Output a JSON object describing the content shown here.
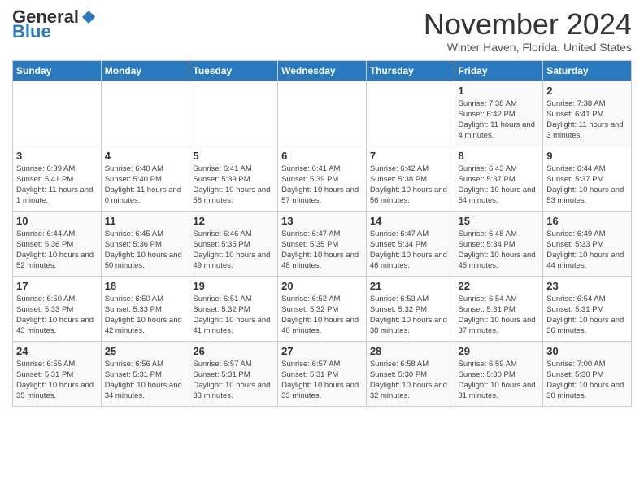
{
  "header": {
    "logo_general": "General",
    "logo_blue": "Blue",
    "month": "November 2024",
    "location": "Winter Haven, Florida, United States"
  },
  "days_of_week": [
    "Sunday",
    "Monday",
    "Tuesday",
    "Wednesday",
    "Thursday",
    "Friday",
    "Saturday"
  ],
  "weeks": [
    [
      {
        "day": "",
        "info": ""
      },
      {
        "day": "",
        "info": ""
      },
      {
        "day": "",
        "info": ""
      },
      {
        "day": "",
        "info": ""
      },
      {
        "day": "",
        "info": ""
      },
      {
        "day": "1",
        "info": "Sunrise: 7:38 AM\nSunset: 6:42 PM\nDaylight: 11 hours and 4 minutes."
      },
      {
        "day": "2",
        "info": "Sunrise: 7:38 AM\nSunset: 6:41 PM\nDaylight: 11 hours and 3 minutes."
      }
    ],
    [
      {
        "day": "3",
        "info": "Sunrise: 6:39 AM\nSunset: 5:41 PM\nDaylight: 11 hours and 1 minute."
      },
      {
        "day": "4",
        "info": "Sunrise: 6:40 AM\nSunset: 5:40 PM\nDaylight: 11 hours and 0 minutes."
      },
      {
        "day": "5",
        "info": "Sunrise: 6:41 AM\nSunset: 5:39 PM\nDaylight: 10 hours and 58 minutes."
      },
      {
        "day": "6",
        "info": "Sunrise: 6:41 AM\nSunset: 5:39 PM\nDaylight: 10 hours and 57 minutes."
      },
      {
        "day": "7",
        "info": "Sunrise: 6:42 AM\nSunset: 5:38 PM\nDaylight: 10 hours and 56 minutes."
      },
      {
        "day": "8",
        "info": "Sunrise: 6:43 AM\nSunset: 5:37 PM\nDaylight: 10 hours and 54 minutes."
      },
      {
        "day": "9",
        "info": "Sunrise: 6:44 AM\nSunset: 5:37 PM\nDaylight: 10 hours and 53 minutes."
      }
    ],
    [
      {
        "day": "10",
        "info": "Sunrise: 6:44 AM\nSunset: 5:36 PM\nDaylight: 10 hours and 52 minutes."
      },
      {
        "day": "11",
        "info": "Sunrise: 6:45 AM\nSunset: 5:36 PM\nDaylight: 10 hours and 50 minutes."
      },
      {
        "day": "12",
        "info": "Sunrise: 6:46 AM\nSunset: 5:35 PM\nDaylight: 10 hours and 49 minutes."
      },
      {
        "day": "13",
        "info": "Sunrise: 6:47 AM\nSunset: 5:35 PM\nDaylight: 10 hours and 48 minutes."
      },
      {
        "day": "14",
        "info": "Sunrise: 6:47 AM\nSunset: 5:34 PM\nDaylight: 10 hours and 46 minutes."
      },
      {
        "day": "15",
        "info": "Sunrise: 6:48 AM\nSunset: 5:34 PM\nDaylight: 10 hours and 45 minutes."
      },
      {
        "day": "16",
        "info": "Sunrise: 6:49 AM\nSunset: 5:33 PM\nDaylight: 10 hours and 44 minutes."
      }
    ],
    [
      {
        "day": "17",
        "info": "Sunrise: 6:50 AM\nSunset: 5:33 PM\nDaylight: 10 hours and 43 minutes."
      },
      {
        "day": "18",
        "info": "Sunrise: 6:50 AM\nSunset: 5:33 PM\nDaylight: 10 hours and 42 minutes."
      },
      {
        "day": "19",
        "info": "Sunrise: 6:51 AM\nSunset: 5:32 PM\nDaylight: 10 hours and 41 minutes."
      },
      {
        "day": "20",
        "info": "Sunrise: 6:52 AM\nSunset: 5:32 PM\nDaylight: 10 hours and 40 minutes."
      },
      {
        "day": "21",
        "info": "Sunrise: 6:53 AM\nSunset: 5:32 PM\nDaylight: 10 hours and 38 minutes."
      },
      {
        "day": "22",
        "info": "Sunrise: 6:54 AM\nSunset: 5:31 PM\nDaylight: 10 hours and 37 minutes."
      },
      {
        "day": "23",
        "info": "Sunrise: 6:54 AM\nSunset: 5:31 PM\nDaylight: 10 hours and 36 minutes."
      }
    ],
    [
      {
        "day": "24",
        "info": "Sunrise: 6:55 AM\nSunset: 5:31 PM\nDaylight: 10 hours and 35 minutes."
      },
      {
        "day": "25",
        "info": "Sunrise: 6:56 AM\nSunset: 5:31 PM\nDaylight: 10 hours and 34 minutes."
      },
      {
        "day": "26",
        "info": "Sunrise: 6:57 AM\nSunset: 5:31 PM\nDaylight: 10 hours and 33 minutes."
      },
      {
        "day": "27",
        "info": "Sunrise: 6:57 AM\nSunset: 5:31 PM\nDaylight: 10 hours and 33 minutes."
      },
      {
        "day": "28",
        "info": "Sunrise: 6:58 AM\nSunset: 5:30 PM\nDaylight: 10 hours and 32 minutes."
      },
      {
        "day": "29",
        "info": "Sunrise: 6:59 AM\nSunset: 5:30 PM\nDaylight: 10 hours and 31 minutes."
      },
      {
        "day": "30",
        "info": "Sunrise: 7:00 AM\nSunset: 5:30 PM\nDaylight: 10 hours and 30 minutes."
      }
    ]
  ]
}
